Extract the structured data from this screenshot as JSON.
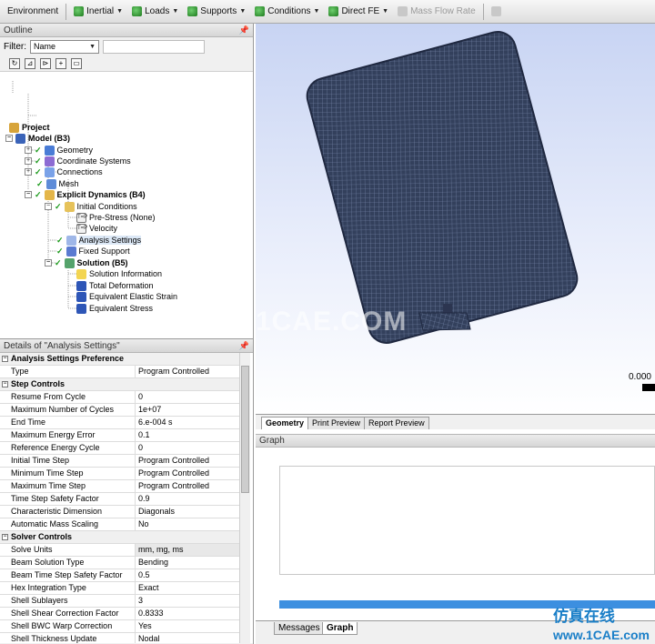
{
  "toolbar": {
    "items": [
      {
        "label": "Environment",
        "icon": "none",
        "dropdown": false
      },
      {
        "label": "Inertial",
        "icon": "inertial-icon",
        "dropdown": true
      },
      {
        "label": "Loads",
        "icon": "loads-icon",
        "dropdown": true
      },
      {
        "label": "Supports",
        "icon": "supports-icon",
        "dropdown": true
      },
      {
        "label": "Conditions",
        "icon": "conditions-icon",
        "dropdown": true
      },
      {
        "label": "Direct FE",
        "icon": "direct-fe-icon",
        "dropdown": true
      },
      {
        "label": "Mass Flow Rate",
        "icon": "mass-flow-icon",
        "dropdown": false,
        "disabled": true
      }
    ]
  },
  "outline": {
    "title": "Outline",
    "filter_label": "Filter:",
    "filter_value": "Name",
    "tree": [
      {
        "label": "Project",
        "bold": true
      },
      {
        "label": "Model (B3)",
        "bold": true
      },
      {
        "label": "Geometry"
      },
      {
        "label": "Coordinate Systems"
      },
      {
        "label": "Connections"
      },
      {
        "label": "Mesh"
      },
      {
        "label": "Explicit Dynamics (B4)",
        "bold": true
      },
      {
        "label": "Initial Conditions"
      },
      {
        "label": "Pre-Stress (None)"
      },
      {
        "label": "Velocity"
      },
      {
        "label": "Analysis Settings",
        "selected": true
      },
      {
        "label": "Fixed Support"
      },
      {
        "label": "Solution (B5)",
        "bold": true
      },
      {
        "label": "Solution Information"
      },
      {
        "label": "Total Deformation"
      },
      {
        "label": "Equivalent Elastic Strain"
      },
      {
        "label": "Equivalent Stress"
      }
    ]
  },
  "details": {
    "title": "Details of \"Analysis Settings\"",
    "rows": [
      {
        "type": "header",
        "label": "Analysis Settings Preference"
      },
      {
        "label": "Type",
        "value": "Program Controlled"
      },
      {
        "type": "header",
        "label": "Step Controls"
      },
      {
        "label": "Resume From Cycle",
        "value": "0"
      },
      {
        "label": "Maximum Number of Cycles",
        "value": "1e+07"
      },
      {
        "label": "End Time",
        "value": "6.e-004 s"
      },
      {
        "label": "Maximum Energy Error",
        "value": "0.1"
      },
      {
        "label": "Reference Energy Cycle",
        "value": "0"
      },
      {
        "label": "Initial Time Step",
        "value": "Program Controlled"
      },
      {
        "label": "Minimum Time Step",
        "value": "Program Controlled"
      },
      {
        "label": "Maximum Time Step",
        "value": "Program Controlled"
      },
      {
        "label": "Time Step Safety Factor",
        "value": "0.9"
      },
      {
        "label": "Characteristic Dimension",
        "value": "Diagonals"
      },
      {
        "label": "Automatic Mass Scaling",
        "value": "No"
      },
      {
        "type": "header",
        "label": "Solver Controls"
      },
      {
        "label": "Solve Units",
        "value": "mm, mg, ms",
        "highlight": true
      },
      {
        "label": "Beam Solution Type",
        "value": "Bending"
      },
      {
        "label": "Beam Time Step Safety Factor",
        "value": "0.5"
      },
      {
        "label": "Hex Integration Type",
        "value": "Exact"
      },
      {
        "label": "Shell Sublayers",
        "value": "3"
      },
      {
        "label": "Shell Shear Correction Factor",
        "value": "0.8333"
      },
      {
        "label": "Shell BWC Warp Correction",
        "value": "Yes"
      },
      {
        "label": "Shell Thickness Update",
        "value": "Nodal"
      }
    ]
  },
  "viewport": {
    "scale_value": "0.000",
    "watermark": "1CAE.COM",
    "colors": {
      "mesh_dark": "#2d3a55",
      "mesh_line": "#6f80a6",
      "bg_top": "#c8d4f3"
    }
  },
  "geometry_tabs": [
    "Geometry",
    "Print Preview",
    "Report Preview"
  ],
  "graph": {
    "title": "Graph"
  },
  "bottom_tabs": [
    {
      "label": "Messages",
      "active": false
    },
    {
      "label": "Graph",
      "active": true
    }
  ],
  "brand_watermark": {
    "cn": "仿真在线",
    "url": "www.1CAE.com"
  }
}
